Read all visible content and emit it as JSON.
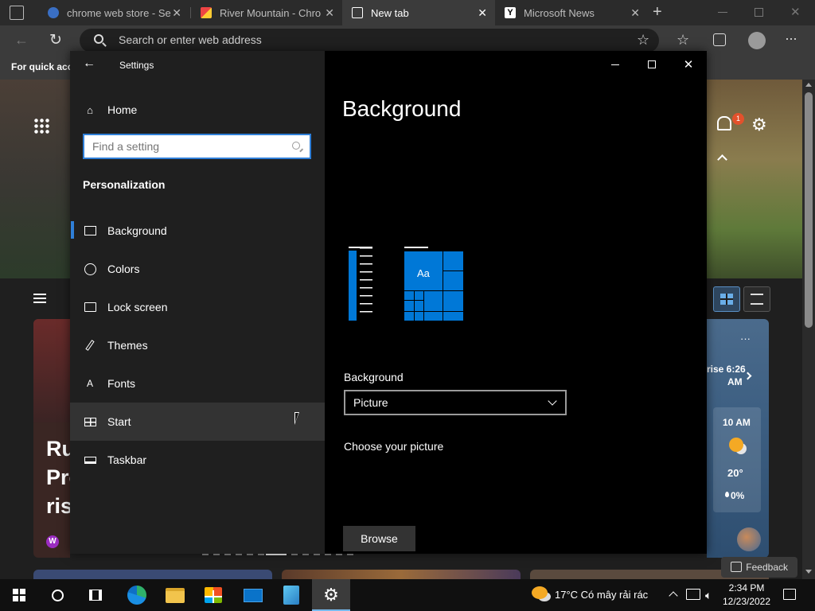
{
  "browser": {
    "tabs": [
      {
        "title": "chrome web store - Se",
        "active": false
      },
      {
        "title": "River Mountain - Chro",
        "active": false
      },
      {
        "title": "New tab",
        "active": true
      },
      {
        "title": "Microsoft News",
        "active": false
      }
    ],
    "address_placeholder": "Search or enter web address",
    "favorites_bar_text": "For quick acce"
  },
  "new_tab_page": {
    "notification_count": "1",
    "headline_lines": [
      "Ru",
      "Pro",
      "ris"
    ],
    "weather": {
      "sunrise": "rise 6:26",
      "sunrise_suffix": "AM",
      "hour": "10 AM",
      "temp": "20°",
      "precip": "0%"
    },
    "feedback_label": "Feedback"
  },
  "settings": {
    "window_title": "Settings",
    "home_label": "Home",
    "search_placeholder": "Find a setting",
    "group_label": "Personalization",
    "nav_items": [
      {
        "label": "Background",
        "icon": "picture-icon",
        "selected": true
      },
      {
        "label": "Colors",
        "icon": "palette-icon",
        "selected": false
      },
      {
        "label": "Lock screen",
        "icon": "lock-screen-icon",
        "selected": false
      },
      {
        "label": "Themes",
        "icon": "brush-icon",
        "selected": false
      },
      {
        "label": "Fonts",
        "icon": "fonts-icon",
        "selected": false
      },
      {
        "label": "Start",
        "icon": "start-icon",
        "selected": false
      },
      {
        "label": "Taskbar",
        "icon": "taskbar-icon",
        "selected": false
      }
    ],
    "page_title": "Background",
    "preview_tile_text": "Aa",
    "background_label": "Background",
    "background_value": "Picture",
    "choose_picture_label": "Choose your picture",
    "browse_label": "Browse",
    "accent_color": "#0078d7"
  },
  "taskbar": {
    "weather_text": "17°C  Có mây rải rác",
    "time": "2:34 PM",
    "date": "12/23/2022"
  }
}
